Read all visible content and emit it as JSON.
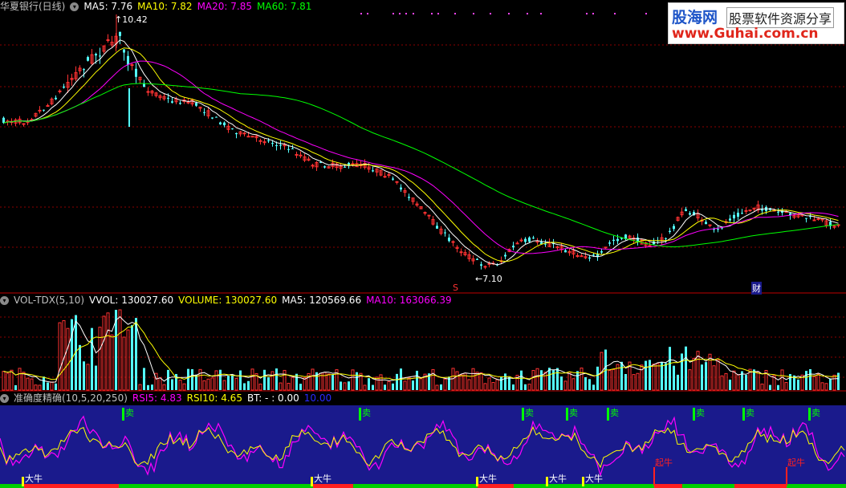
{
  "main_panel": {
    "title": "华夏银行(日线)",
    "ma": [
      {
        "label": "MA5: 7.76",
        "color": "#ffffff"
      },
      {
        "label": "MA10: 7.82",
        "color": "#ffff00"
      },
      {
        "label": "MA20: 7.85",
        "color": "#ff00ff"
      },
      {
        "label": "MA60: 7.81",
        "color": "#00ff00"
      }
    ],
    "high_label": "10.42",
    "low_label": "7.10",
    "marker_s": "S",
    "marker_cai": "财"
  },
  "vol_panel": {
    "title": "VOL-TDX(5,10)",
    "items": [
      {
        "label": "VVOL: 130027.60",
        "color": "#ffffff"
      },
      {
        "label": "VOLUME: 130027.60",
        "color": "#ffff00"
      },
      {
        "label": "MA5: 120569.66",
        "color": "#ffffff"
      },
      {
        "label": "MA10: 163066.39",
        "color": "#ff00ff"
      }
    ]
  },
  "ind_panel": {
    "title": "准确度精确(10,5,20,250)",
    "items": [
      {
        "label": "RSI5: 4.83",
        "color": "#ff00ff"
      },
      {
        "label": "RSI10: 4.65",
        "color": "#ffff00"
      },
      {
        "label": "BT: - : 0.00",
        "color": "#ffffff"
      },
      {
        "label": "10.00",
        "color": "#2a2aff"
      }
    ],
    "sell_label": "卖",
    "bull_label": "大牛",
    "start_bull_label": "起牛"
  },
  "logo": {
    "line1": "股海网",
    "line1b": "股票软件资源分享",
    "line2": "www.Guhai.com.cn"
  },
  "colors": {
    "up": "#ff3232",
    "down": "#54ffff",
    "grid": "#8b0000",
    "ind_bg": "#1a1a8c"
  }
}
